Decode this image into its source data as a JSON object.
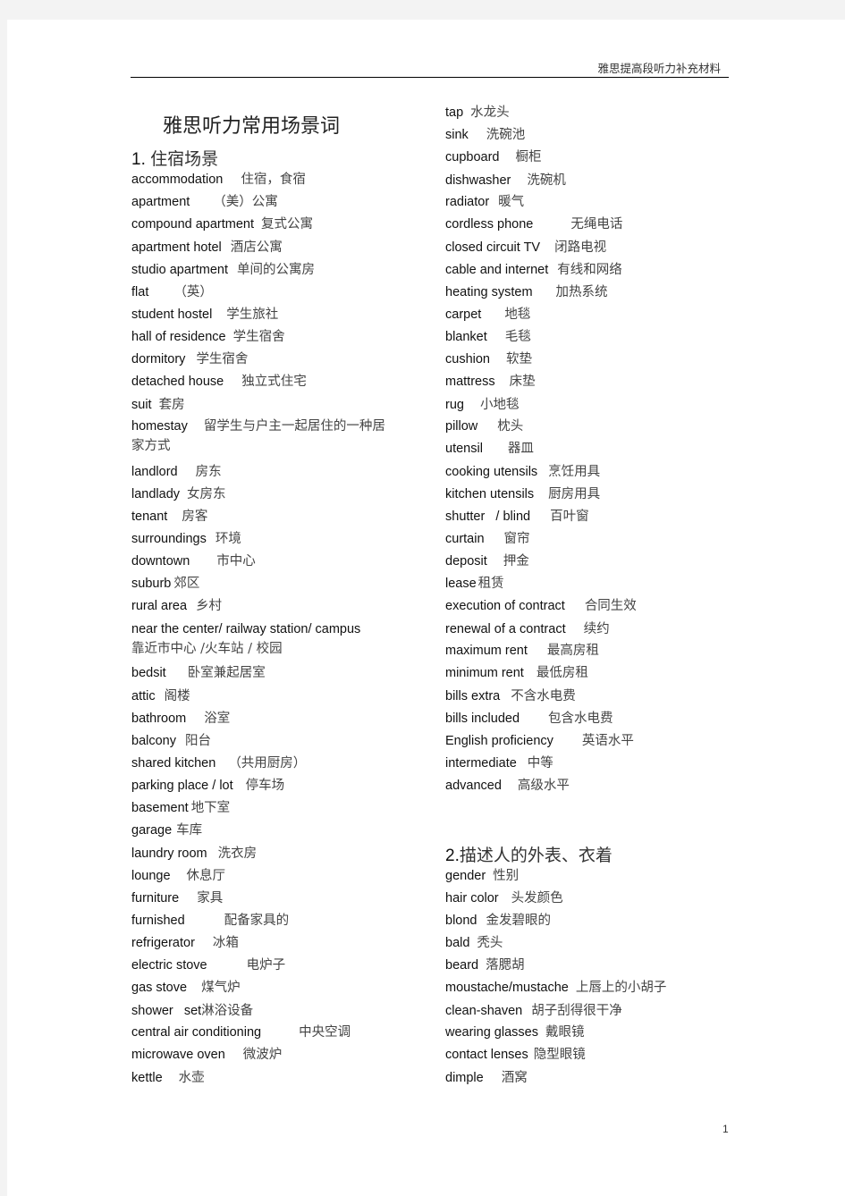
{
  "header": {
    "running_title": "雅思提高段听力补充材料"
  },
  "document": {
    "title": "雅思听力常用场景词"
  },
  "sections": [
    {
      "heading_num": "1.",
      "heading_text": "住宿场景",
      "entries": [
        {
          "en": "accommodation",
          "zh": "住宿，食宿"
        },
        {
          "en": "apartment",
          "zh": "（美）公寓"
        },
        {
          "en": "compound apartment",
          "zh": "复式公寓"
        },
        {
          "en": "apartment hotel",
          "zh": "酒店公寓"
        },
        {
          "en": "studio apartment",
          "zh": "单间的公寓房"
        },
        {
          "en": "flat",
          "zh": "（英）"
        },
        {
          "en": "student hostel",
          "zh": "学生旅社"
        },
        {
          "en": "hall of residence",
          "zh": "学生宿舍"
        },
        {
          "en": "dormitory",
          "zh": "学生宿舍"
        },
        {
          "en": "detached house",
          "zh": "独立式住宅"
        },
        {
          "en": "suit",
          "zh": "套房"
        },
        {
          "en": "homestay",
          "zh": "留学生与户主一起居住的一种居家方式"
        },
        {
          "en": "landlord",
          "zh": "房东"
        },
        {
          "en": "landlady",
          "zh": "女房东"
        },
        {
          "en": "tenant",
          "zh": "房客"
        },
        {
          "en": "surroundings",
          "zh": "环境"
        },
        {
          "en": "downtown",
          "zh": "市中心"
        },
        {
          "en": "suburb",
          "zh": "郊区"
        },
        {
          "en": "rural area",
          "zh": "乡村"
        },
        {
          "en": "near the center/ railway station/ campus",
          "zh": "靠近市中心 /火车站 / 校园"
        },
        {
          "en": "bedsit",
          "zh": "卧室兼起居室"
        },
        {
          "en": "attic",
          "zh": "阁楼"
        },
        {
          "en": "bathroom",
          "zh": "浴室"
        },
        {
          "en": "balcony",
          "zh": "阳台"
        },
        {
          "en": "shared kitchen",
          "zh": "（共用厨房）"
        },
        {
          "en": "parking place / lot",
          "zh": "停车场"
        },
        {
          "en": "basement",
          "zh": "地下室"
        },
        {
          "en": "garage",
          "zh": "车库"
        },
        {
          "en": "laundry room",
          "zh": "洗衣房"
        },
        {
          "en": "lounge",
          "zh": "休息厅"
        },
        {
          "en": "furniture",
          "zh": "家具"
        },
        {
          "en": "furnished",
          "zh": "配备家具的"
        },
        {
          "en": "refrigerator",
          "zh": "冰箱"
        },
        {
          "en": "electric stove",
          "zh": "电炉子"
        },
        {
          "en": "gas stove",
          "zh": "煤气炉"
        },
        {
          "en": "shower   set",
          "zh": "淋浴设备"
        },
        {
          "en": "central air conditioning",
          "zh": "中央空调"
        },
        {
          "en": "microwave oven",
          "zh": "微波炉"
        },
        {
          "en": "kettle",
          "zh": "水壶"
        },
        {
          "en": "tap",
          "zh": "水龙头"
        },
        {
          "en": "sink",
          "zh": "洗碗池"
        },
        {
          "en": "cupboard",
          "zh": "橱柜"
        },
        {
          "en": "dishwasher",
          "zh": "洗碗机"
        },
        {
          "en": "radiator",
          "zh": "暖气"
        },
        {
          "en": "cordless phone",
          "zh": "无绳电话"
        },
        {
          "en": "closed circuit TV",
          "zh": "闭路电视"
        },
        {
          "en": "cable and internet",
          "zh": "有线和网络"
        },
        {
          "en": "heating system",
          "zh": "加热系统"
        },
        {
          "en": "carpet",
          "zh": "地毯"
        },
        {
          "en": "blanket",
          "zh": "毛毯"
        },
        {
          "en": "cushion",
          "zh": "软垫"
        },
        {
          "en": "mattress",
          "zh": "床垫"
        },
        {
          "en": "rug",
          "zh": "小地毯"
        },
        {
          "en": "pillow",
          "zh": "枕头"
        },
        {
          "en": "utensil",
          "zh": "器皿"
        },
        {
          "en": "cooking utensils",
          "zh": "烹饪用具"
        },
        {
          "en": "kitchen utensils",
          "zh": "厨房用具"
        },
        {
          "en": "shutter   / blind",
          "zh": "百叶窗"
        },
        {
          "en": "curtain",
          "zh": "窗帘"
        },
        {
          "en": "deposit",
          "zh": "押金"
        },
        {
          "en": "lease",
          "zh": "租赁"
        },
        {
          "en": "execution of contract",
          "zh": "合同生效"
        },
        {
          "en": "renewal of a contract",
          "zh": "续约"
        },
        {
          "en": "maximum rent",
          "zh": "最高房租"
        },
        {
          "en": "minimum rent",
          "zh": "最低房租"
        },
        {
          "en": "bills extra",
          "zh": "不含水电费"
        },
        {
          "en": "bills included",
          "zh": "包含水电费"
        },
        {
          "en": "English proficiency",
          "zh": "英语水平"
        },
        {
          "en": "intermediate",
          "zh": "中等"
        },
        {
          "en": "advanced",
          "zh": "高级水平"
        }
      ]
    },
    {
      "heading_num": "2.",
      "heading_text": "描述人的外表、衣着",
      "entries": [
        {
          "en": "gender",
          "zh": "性别"
        },
        {
          "en": "hair color",
          "zh": "头发颜色"
        },
        {
          "en": "blond",
          "zh": "金发碧眼的"
        },
        {
          "en": "bald",
          "zh": "秃头"
        },
        {
          "en": "beard",
          "zh": "落腮胡"
        },
        {
          "en": "moustache/mustache",
          "zh": "上唇上的小胡子"
        },
        {
          "en": "clean-shaven",
          "zh": "胡子刮得很干净"
        },
        {
          "en": "wearing glasses",
          "zh": "戴眼镜"
        },
        {
          "en": "contact lenses",
          "zh": "隐型眼镜"
        },
        {
          "en": "dimple",
          "zh": "酒窝"
        }
      ]
    }
  ],
  "footer": {
    "page_number": "1"
  }
}
